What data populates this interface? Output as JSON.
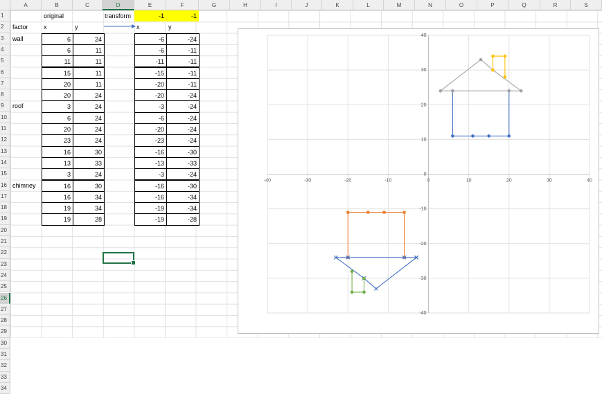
{
  "columns": [
    "A",
    "B",
    "C",
    "D",
    "E",
    "F",
    "G",
    "H",
    "I",
    "J",
    "K",
    "L",
    "M",
    "N",
    "O",
    "P",
    "Q",
    "R",
    "S"
  ],
  "selected_column": "D",
  "selected_row": 26,
  "rows": [
    1,
    2,
    3,
    4,
    5,
    6,
    7,
    8,
    9,
    10,
    11,
    12,
    13,
    14,
    15,
    16,
    17,
    18,
    19,
    20,
    21,
    22,
    23,
    24,
    25,
    26,
    27,
    28,
    29,
    30,
    31,
    32,
    33,
    34
  ],
  "sheet": {
    "b1": "original",
    "d1": "transform",
    "e1": "-1",
    "f1": "-1",
    "a2": "factor",
    "b2": "x",
    "c2": "y",
    "e2": "x",
    "f2": "y",
    "labels": [
      {
        "row": 3,
        "text": "wall"
      },
      {
        "row": 9,
        "text": "roof"
      },
      {
        "row": 16,
        "text": "chimney"
      }
    ],
    "table": [
      [
        6,
        24,
        -6,
        -24
      ],
      [
        6,
        11,
        -6,
        -11
      ],
      [
        11,
        11,
        -11,
        -11
      ],
      [
        15,
        11,
        -15,
        -11
      ],
      [
        20,
        11,
        -20,
        -11
      ],
      [
        20,
        24,
        -20,
        -24
      ],
      [
        3,
        24,
        -3,
        -24
      ],
      [
        6,
        24,
        -6,
        -24
      ],
      [
        20,
        24,
        -20,
        -24
      ],
      [
        23,
        24,
        -23,
        -24
      ],
      [
        16,
        30,
        -16,
        -30
      ],
      [
        13,
        33,
        -13,
        -33
      ],
      [
        3,
        24,
        -3,
        -24
      ],
      [
        16,
        30,
        -16,
        -30
      ],
      [
        16,
        34,
        -16,
        -34
      ],
      [
        19,
        34,
        -19,
        -34
      ],
      [
        19,
        28,
        -19,
        -28
      ]
    ]
  },
  "chart_data": {
    "type": "scatter",
    "xlim": [
      -40,
      40
    ],
    "ylim": [
      -40,
      40
    ],
    "xticks": [
      -40,
      -30,
      -20,
      -10,
      0,
      10,
      20,
      30,
      40
    ],
    "yticks": [
      40,
      30,
      20,
      10,
      0,
      -10,
      -20,
      -30,
      -40
    ],
    "grid": true,
    "series": [
      {
        "color": "#4472c4",
        "marker": "circle",
        "points": [
          [
            6,
            24
          ],
          [
            6,
            11
          ],
          [
            11,
            11
          ],
          [
            15,
            11
          ],
          [
            20,
            11
          ],
          [
            20,
            24
          ]
        ]
      },
      {
        "color": "#a5a5a5",
        "marker": "circle",
        "points": [
          [
            3,
            24
          ],
          [
            6,
            24
          ],
          [
            20,
            24
          ],
          [
            23,
            24
          ],
          [
            16,
            30
          ],
          [
            13,
            33
          ],
          [
            3,
            24
          ]
        ]
      },
      {
        "color": "#ffc000",
        "marker": "circle",
        "points": [
          [
            16,
            30
          ],
          [
            16,
            34
          ],
          [
            19,
            34
          ],
          [
            19,
            28
          ]
        ]
      },
      {
        "color": "#ed7d31",
        "marker": "square",
        "points": [
          [
            -6,
            -24
          ],
          [
            -6,
            -11
          ],
          [
            -11,
            -11
          ],
          [
            -15,
            -11
          ],
          [
            -20,
            -11
          ],
          [
            -20,
            -24
          ]
        ]
      },
      {
        "color": "#4472c4",
        "marker": "x",
        "points": [
          [
            -3,
            -24
          ],
          [
            -6,
            -24
          ],
          [
            -20,
            -24
          ],
          [
            -23,
            -24
          ],
          [
            -16,
            -30
          ],
          [
            -13,
            -33
          ],
          [
            -3,
            -24
          ]
        ]
      },
      {
        "color": "#70ad47",
        "marker": "circle",
        "points": [
          [
            -16,
            -30
          ],
          [
            -16,
            -34
          ],
          [
            -19,
            -34
          ],
          [
            -19,
            -28
          ]
        ]
      }
    ]
  }
}
